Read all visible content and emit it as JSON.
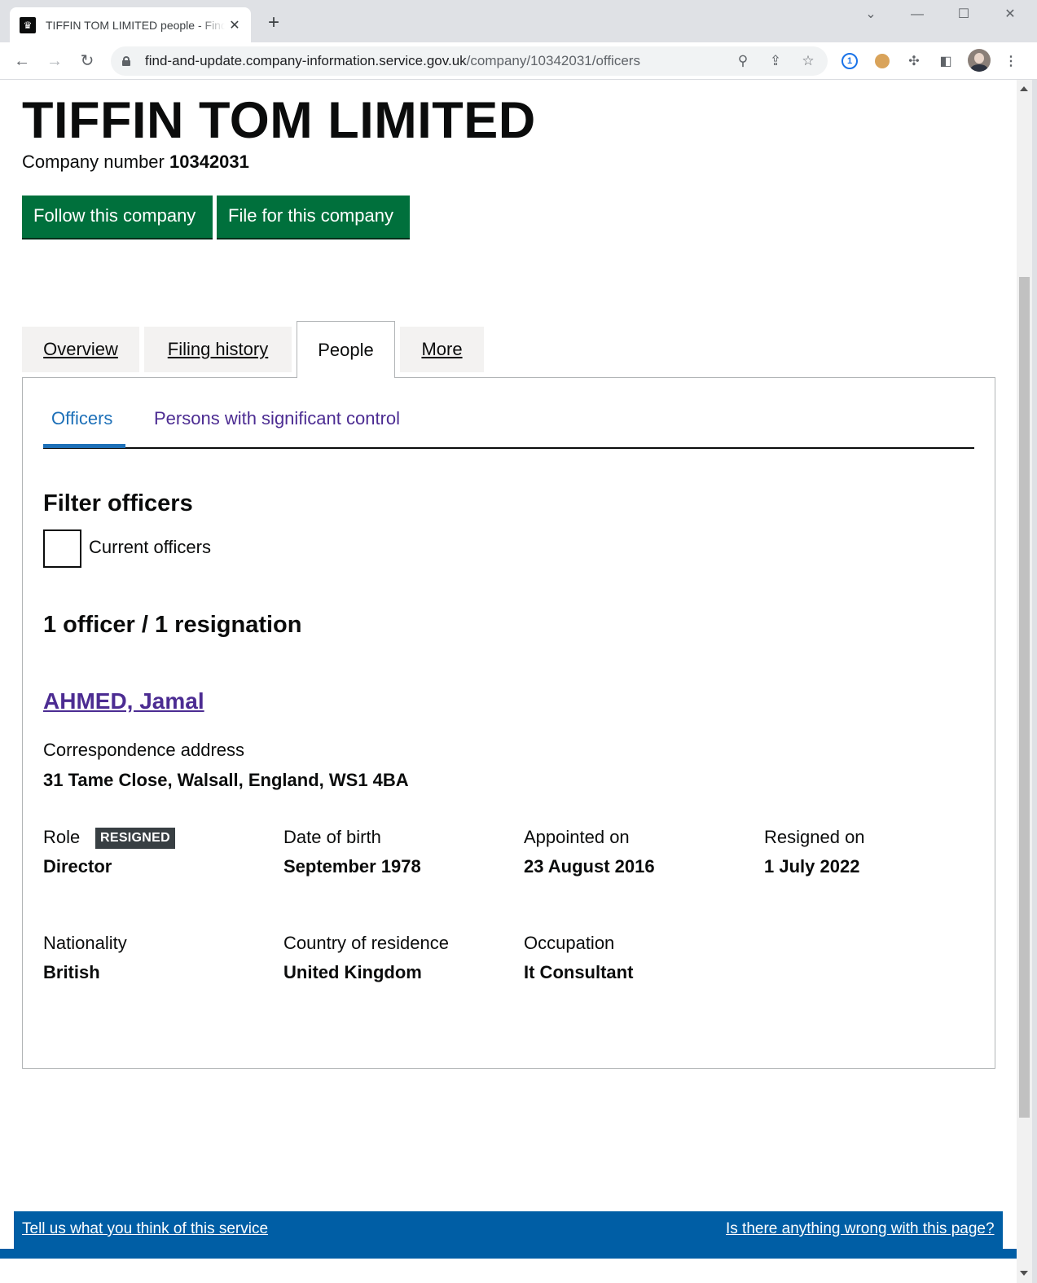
{
  "browser": {
    "tab_title": "TIFFIN TOM LIMITED people - Find and update company information - GOV.UK",
    "url_domain": "find-and-update.company-information.service.gov.uk",
    "url_path": "/company/10342031/officers"
  },
  "company": {
    "name": "TIFFIN TOM LIMITED",
    "number_label": "Company number",
    "number": "10342031"
  },
  "actions": {
    "follow": "Follow this company",
    "file": "File for this company"
  },
  "tabs": [
    {
      "label": "Overview",
      "active": false
    },
    {
      "label": "Filing history",
      "active": false
    },
    {
      "label": "People",
      "active": true
    },
    {
      "label": "More",
      "active": false
    }
  ],
  "subtabs": [
    {
      "label": "Officers",
      "active": true
    },
    {
      "label": "Persons with significant control",
      "active": false
    }
  ],
  "filter": {
    "heading": "Filter officers",
    "checkbox_label": "Current officers",
    "checked": false
  },
  "summary": "1 officer / 1 resignation",
  "officer": {
    "name": "AHMED, Jamal",
    "address_label": "Correspondence address",
    "address": "31 Tame Close, Walsall, England, WS1 4BA",
    "role_label": "Role",
    "status_tag": "RESIGNED",
    "role": "Director",
    "dob_label": "Date of birth",
    "dob": "September 1978",
    "appointed_label": "Appointed on",
    "appointed": "23 August 2016",
    "resigned_label": "Resigned on",
    "resigned": "1 July 2022",
    "nationality_label": "Nationality",
    "nationality": "British",
    "residence_label": "Country of residence",
    "residence": "United Kingdom",
    "occupation_label": "Occupation",
    "occupation": "It Consultant"
  },
  "feedback": {
    "left": "Tell us what you think of this service",
    "right": "Is there anything wrong with this page?"
  },
  "colors": {
    "button_green": "#00703c",
    "link_blue": "#1d70b8",
    "link_purple": "#4c2c92",
    "feedback_blue": "#005ea5",
    "tag_grey": "#383f43"
  }
}
